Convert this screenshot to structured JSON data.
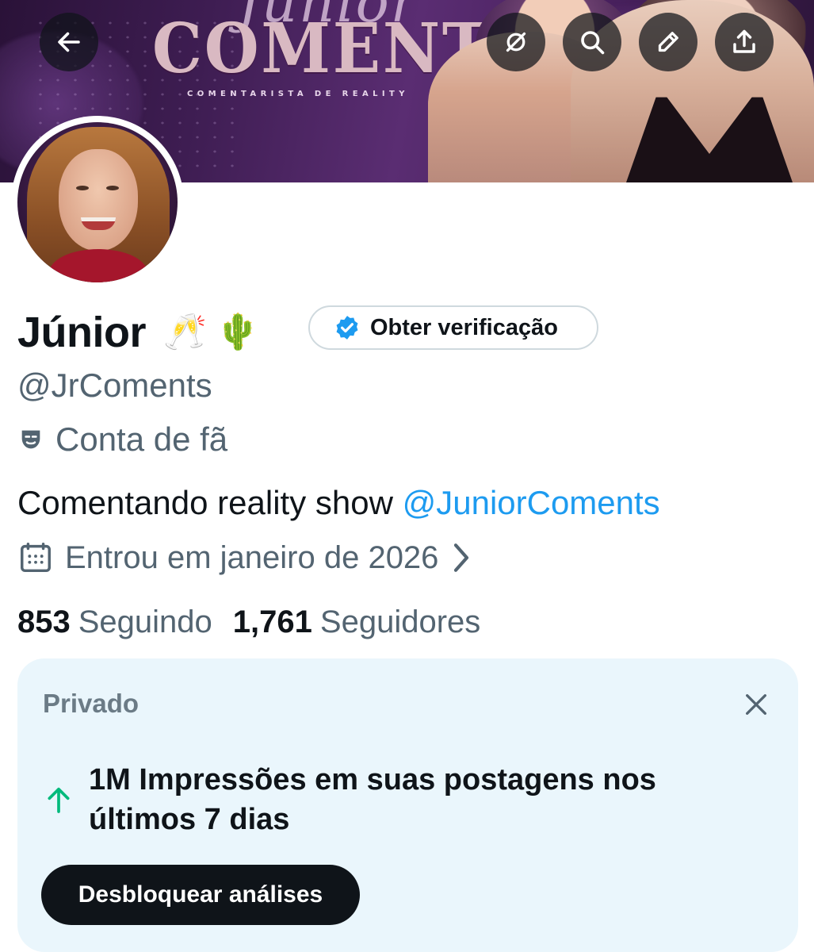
{
  "banner": {
    "script_text": "Júnior",
    "title": "COMENTS",
    "subtitle": "COMENTARISTA DE REALITY"
  },
  "header_buttons": [
    {
      "icon": "back-arrow-icon"
    },
    {
      "icon": "grok-icon"
    },
    {
      "icon": "search-icon"
    },
    {
      "icon": "edit-pencil-icon"
    },
    {
      "icon": "share-icon"
    }
  ],
  "profile": {
    "name": "Júnior",
    "name_emojis": [
      "🥂",
      "🌵"
    ],
    "verify_button_label": "Obter verificação",
    "handle": "@JrComents",
    "fan_label": "Conta de fã",
    "bio_text": "Comentando reality show ",
    "bio_mention": "@JuniorComents",
    "joined": "Entrou em janeiro de 2026",
    "following_count": "853",
    "following_label": "Seguindo",
    "followers_count": "1,761",
    "followers_label": "Seguidores"
  },
  "private_card": {
    "title": "Privado",
    "impressions_text": "1M Impressões em suas postagens nos últimos 7 dias",
    "button_label": "Desbloquear análises"
  },
  "colors": {
    "accent_blue": "#1d9bf0",
    "secondary_text": "#536471",
    "card_background": "#eaf6fc",
    "up_arrow_green": "#00ba7c"
  }
}
